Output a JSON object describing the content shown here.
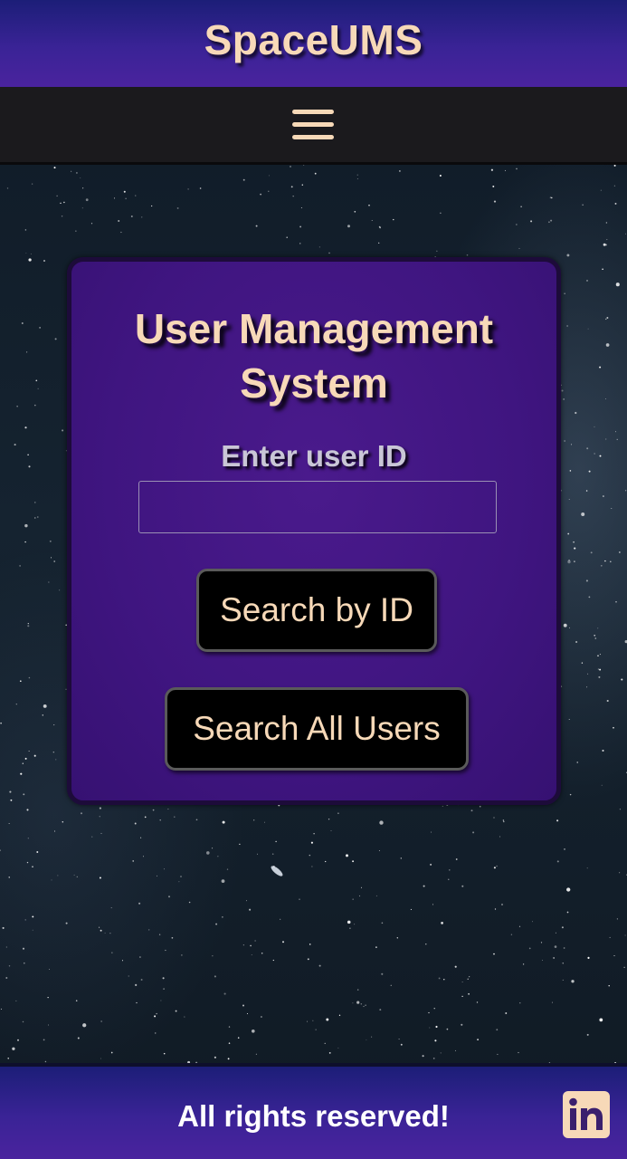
{
  "header": {
    "brand": "SpaceUMS"
  },
  "nav": {
    "menu_icon": "hamburger-menu-icon"
  },
  "main": {
    "title": "User Management System",
    "field_label": "Enter user ID",
    "user_id_value": "",
    "search_by_id_label": "Search by ID",
    "search_all_label": "Search All Users"
  },
  "footer": {
    "text": "All rights reserved!",
    "social_icon": "linkedin-icon"
  },
  "colors": {
    "accent_text": "#f7d9b8",
    "header_gradient_start": "#1c1e78",
    "header_gradient_end": "#4a239e",
    "card_background": "#3f1580",
    "navbar_background": "#1b1a1d",
    "button_background": "#000000"
  }
}
